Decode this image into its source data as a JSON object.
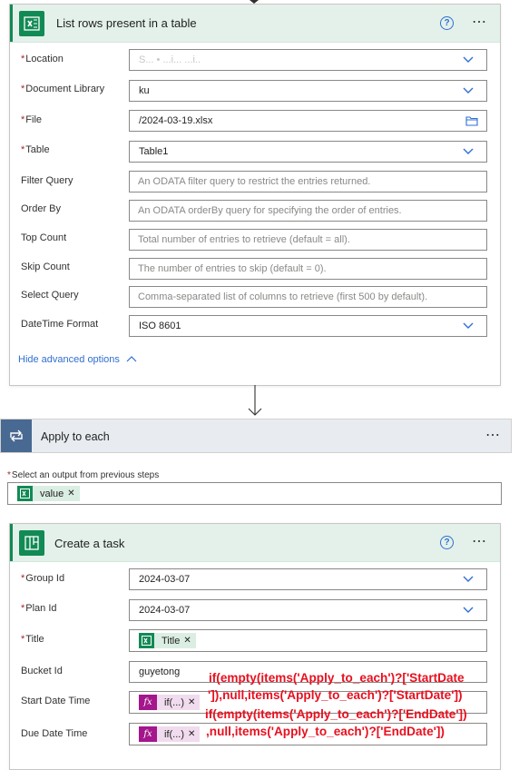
{
  "list_rows": {
    "title": "List rows present in a table",
    "help_icon": "?",
    "more_icon": "⋯",
    "fields": {
      "location": {
        "label": "Location",
        "value": "S... • ...i... ...i.."
      },
      "document_library": {
        "label": "Document Library",
        "value": "ku"
      },
      "file": {
        "label": "File",
        "value": "/2024-03-19.xlsx"
      },
      "table": {
        "label": "Table",
        "value": "Table1"
      },
      "filter_query": {
        "label": "Filter Query",
        "placeholder": "An ODATA filter query to restrict the entries returned."
      },
      "order_by": {
        "label": "Order By",
        "placeholder": "An ODATA orderBy query for specifying the order of entries."
      },
      "top_count": {
        "label": "Top Count",
        "placeholder": "Total number of entries to retrieve (default = all)."
      },
      "skip_count": {
        "label": "Skip Count",
        "placeholder": "The number of entries to skip (default = 0)."
      },
      "select_query": {
        "label": "Select Query",
        "placeholder": "Comma-separated list of columns to retrieve (first 500 by default)."
      },
      "datetime_format": {
        "label": "DateTime Format",
        "value": "ISO 8601"
      }
    },
    "hide_advanced": "Hide advanced options"
  },
  "apply_each": {
    "title": "Apply to each",
    "more_icon": "⋯",
    "select_label": "Select an output from previous steps",
    "token": "value"
  },
  "create_task": {
    "title": "Create a task",
    "help_icon": "?",
    "more_icon": "⋯",
    "fields": {
      "group_id": {
        "label": "Group Id",
        "value": "2024-03-07"
      },
      "plan_id": {
        "label": "Plan Id",
        "value": "2024-03-07"
      },
      "title": {
        "label": "Title",
        "token": "Title"
      },
      "bucket_id": {
        "label": "Bucket Id",
        "value": "guyetong"
      },
      "start_date": {
        "label": "Start Date Time",
        "token": "if(...)"
      },
      "due_date": {
        "label": "Due Date Time",
        "token": "if(...)"
      }
    }
  },
  "annotation": {
    "line1": "if(empty(items('Apply_to_each')?['StartDate",
    "line2": "']),null,items('Apply_to_each')?['StartDate'])",
    "line3": "if(empty(items('Apply_to_each')?['EndDate'])",
    "line4": ",null,items('Apply_to_each')?['EndDate'])"
  },
  "colors": {
    "excel_green": "#128a55",
    "header_bg": "#e3f1ea",
    "link_blue": "#2f6fd1",
    "expression_pink": "#a4168c",
    "annotation_red": "#e8101f",
    "required_red": "#a4262c"
  }
}
